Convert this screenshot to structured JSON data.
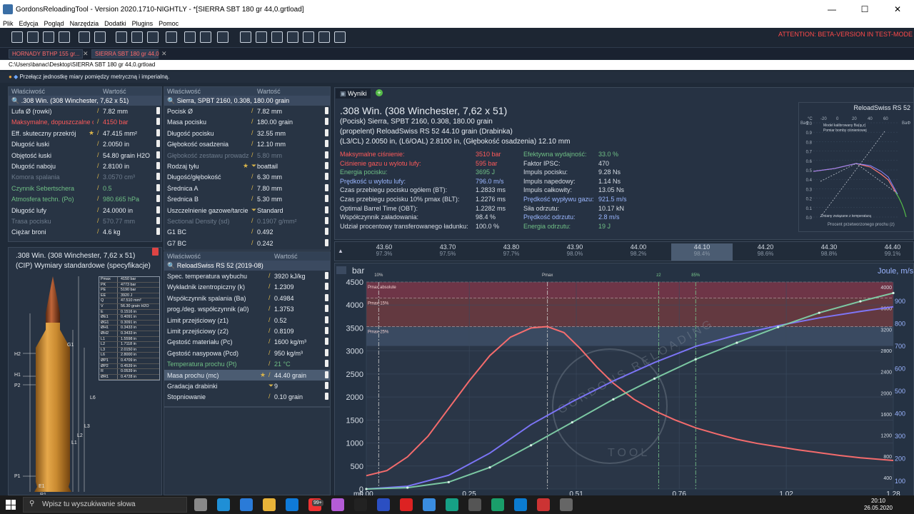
{
  "window": {
    "title": "GordonsReloadingTool - Version 2020.1710-NIGHTLY - *[SIERRA SBT 180 gr  44,0.grtload]",
    "minimize": "—",
    "maximize": "☐",
    "close": "✕"
  },
  "menu": [
    "Plik",
    "Edycja",
    "Pogląd",
    "Narzędzia",
    "Dodatki",
    "Plugins",
    "Pomoc"
  ],
  "attention": "ATTENTION: BETA-VERSION IN TEST-MODE",
  "tabs": [
    {
      "label": "HORNADY BTHP 155 gr..."
    },
    {
      "label": "SIERRA SBT 180 gr  44,0"
    }
  ],
  "tab_close": "✕",
  "path": "C:\\Users\\banac\\Desktop\\SIERRA SBT 180 gr  44,0.grtload",
  "hint": "Przełącz jednostkę miary pomiędzy metryczną i imperialną.",
  "colhdr": {
    "property": "Właściwość",
    "value": "Wartość"
  },
  "cartridge": {
    "name": ".308 Win. (308 Winchester, 7,62 x 51)",
    "rows": [
      {
        "n": "Lufa Ø (rowki)",
        "v": "7.82 mm",
        "c": ""
      },
      {
        "n": "Maksymalne, dopuszczalne ciśnienie",
        "v": "4150 bar",
        "c": "red"
      },
      {
        "n": "Eff. skuteczny przekrój",
        "v": "47.415 mm²",
        "c": "",
        "star": true
      },
      {
        "n": "Długość łuski",
        "v": "2.0050 in",
        "c": ""
      },
      {
        "n": "Objętość łuski",
        "v": "54.80 grain H2O",
        "c": ""
      },
      {
        "n": "Długość naboju",
        "v": "2.8100 in",
        "c": ""
      },
      {
        "n": "Komora spalania",
        "v": "3.0570 cm³",
        "c": "dim"
      },
      {
        "n": "Czynnik Sebertschera",
        "v": "0.5",
        "c": "green"
      },
      {
        "n": "Atmosfera techn. (Po)",
        "v": "980.665 hPa",
        "c": "green"
      },
      {
        "n": "Długość lufy",
        "v": "24.0000 in",
        "c": ""
      },
      {
        "n": "Trasa pocisku",
        "v": "570.77 mm",
        "c": "dim"
      },
      {
        "n": "Ciężar broni",
        "v": "4.6 kg",
        "c": ""
      }
    ]
  },
  "bullet": {
    "name": "Sierra, SPBT 2160, 0.308, 180.00 grain",
    "rows": [
      {
        "n": "Pocisk Ø",
        "v": "7.82 mm",
        "c": ""
      },
      {
        "n": "Masa pocisku",
        "v": "180.00 grain",
        "c": ""
      },
      {
        "n": "Długość pocisku",
        "v": "32.55 mm",
        "c": ""
      },
      {
        "n": "Głębokość osadzenia",
        "v": "12.10 mm",
        "c": ""
      },
      {
        "n": "Głębokość zestawu prowadzącego",
        "v": "5.80 mm",
        "c": "dim"
      },
      {
        "n": "Rodzaj tyłu",
        "v": "boattail",
        "c": "",
        "star": true,
        "dd": true
      },
      {
        "n": "Długość/głębokość",
        "v": "6.30 mm",
        "c": ""
      },
      {
        "n": "Średnica A",
        "v": "7.80 mm",
        "c": ""
      },
      {
        "n": "Średnica B",
        "v": "5.30 mm",
        "c": ""
      },
      {
        "n": "Uszczelnienie gazowe/tarcie",
        "v": "Standard",
        "c": "",
        "dd": true
      },
      {
        "n": "Sectional Density (sd)",
        "v": "0.1907 g/mm²",
        "c": "dim"
      },
      {
        "n": "G1 BC",
        "v": "0.492",
        "c": ""
      },
      {
        "n": "G7 BC",
        "v": "0.242",
        "c": ""
      }
    ]
  },
  "powder": {
    "name": "ReloadSwiss RS 52 (2019-08)",
    "rows": [
      {
        "n": "Spec. temperatura wybuchu (Qex)",
        "v": "3920 kJ/kg",
        "c": ""
      },
      {
        "n": "Wykładnik izentropiczny (k)",
        "v": "1.2309",
        "c": ""
      },
      {
        "n": "Współczynnik spalania (Ba)",
        "v": "0.4984",
        "c": ""
      },
      {
        "n": "prog./deg. współczynnik (a0)",
        "v": "1.3753",
        "c": ""
      },
      {
        "n": "Limit przejściowy (z1)",
        "v": "0.52",
        "c": ""
      },
      {
        "n": "Limit przejściowy (z2)",
        "v": "0.8109",
        "c": ""
      },
      {
        "n": "Gęstość materiału (Pc)",
        "v": "1600 kg/m³",
        "c": ""
      },
      {
        "n": "Gęstość nasypowa (Pcd)",
        "v": "950 kg/m³",
        "c": ""
      },
      {
        "n": "Temperatura prochu (Pt)",
        "v": "21 °C",
        "c": "green"
      },
      {
        "n": "Masa prochu (mc)",
        "v": "44.40 grain",
        "c": "sel",
        "star": true
      },
      {
        "n": "Gradacja drabinki",
        "v": "9",
        "c": "",
        "dd": true
      },
      {
        "n": "Stopniowanie",
        "v": "0.10 grain",
        "c": ""
      }
    ]
  },
  "cip": {
    "title1": ".308 Win. (308 Winchester, 7,62 x 51)",
    "title2": "(CIP) Wymiary standardowe (specyfikacje)",
    "table": [
      [
        "Pmax",
        "4150 bar"
      ],
      [
        "PK",
        "4773 bar"
      ],
      [
        "PE",
        "5190 bar"
      ],
      [
        "EE",
        "3920 J"
      ],
      [
        "Q",
        "47.510 mm²"
      ],
      [
        "V",
        "56.30 grain H2O"
      ],
      [
        "E",
        "0.1516 in"
      ],
      [
        "ØE1",
        "0.4091 in"
      ],
      [
        "ØG1",
        "0.3091 in"
      ],
      [
        "ØH1",
        "0.3433 in"
      ],
      [
        "ØH2",
        "0.3433 in"
      ],
      [
        "L1",
        "1.5598 in"
      ],
      [
        "L2",
        "1.7118 in"
      ],
      [
        "L3",
        "2.0150 in"
      ],
      [
        "L6",
        "2.8000 in"
      ],
      [
        "ØP1",
        "0.4709 in"
      ],
      [
        "ØP2",
        "0.4539 in"
      ],
      [
        "R",
        "0.0539 in"
      ],
      [
        "ØR1",
        "0.4728 in"
      ]
    ],
    "labels": [
      "H2",
      "G1",
      "H1",
      "P2",
      "L6",
      "L3",
      "L2",
      "L1",
      "P1",
      "E1",
      "R1"
    ]
  },
  "results": {
    "tab": "Wyniki",
    "title": ".308 Win. (308 Winchester, 7,62 x 51)",
    "lines": [
      "(Pocisk) Sierra, SPBT 2160, 0.308, 180.00 grain",
      "(propelent) ReloadSwiss RS 52 44.10 grain (Drabinka)",
      "(L3/CL) 2.0050 in, (L6/OAL) 2.8100 in, (Głębokość osadzenia) 12.10 mm"
    ],
    "left": [
      {
        "n": "Maksymalne ciśnienie:",
        "v": "3510 bar",
        "c": "red"
      },
      {
        "n": "Ciśnienie gazu u wylotu lufy:",
        "v": "595 bar",
        "c": "red"
      },
      {
        "n": "Energia pocisku:",
        "v": "3695 J",
        "c": "green"
      },
      {
        "n": "Prędkość u wylotu lufy:",
        "v": "796.0 m/s",
        "c": "blue"
      },
      {
        "n": "Czas przebiegu pocisku ogółem (BT):",
        "v": "1.2833 ms",
        "c": ""
      },
      {
        "n": "Czas przebiegu pocisku 10% pmax (BLT):",
        "v": "1.2276 ms",
        "c": ""
      },
      {
        "n": "Optimal Barrel Time (OBT):",
        "v": "1.2282 ms",
        "c": ""
      },
      {
        "n": "Współczynnik załadowania:",
        "v": "98.4 %",
        "c": ""
      },
      {
        "n": "Udział procentowy transferowanego ładunku:",
        "v": "100.0 %",
        "c": ""
      }
    ],
    "right": [
      {
        "n": "Efektywna wydajność:",
        "v": "33.0 %",
        "c": "green"
      },
      {
        "n": "Faktor IPSC:",
        "v": "470",
        "c": ""
      },
      {
        "n": "Impuls pocisku:",
        "v": "9.28 Ns",
        "c": ""
      },
      {
        "n": "Impuls napedowy:",
        "v": "1.14 Ns",
        "c": ""
      },
      {
        "n": "Impuls całkowity:",
        "v": "13.05 Ns",
        "c": ""
      },
      {
        "n": "Prędkość wypływu gazu:",
        "v": "921.5 m/s",
        "c": "blue"
      },
      {
        "n": "Siła odrzutu:",
        "v": "10.17 kN",
        "c": ""
      },
      {
        "n": "Prędkość odrzutu:",
        "v": "2.8 m/s",
        "c": "blue"
      },
      {
        "n": "Energia odrzutu:",
        "v": "19 J",
        "c": "green"
      }
    ]
  },
  "mini": {
    "title": "ReloadSwiss RS 52",
    "legend1": "Model kalibrowany Ba(φ,z)",
    "legend2": "Pomiar bomby ciśnieniowej",
    "note": "Zmiany związane z temperaturą",
    "xlabel": "Procent przetworzonego prochu (z)",
    "yticks": [
      "1.0",
      "0.9",
      "0.8",
      "0.7",
      "0.6",
      "0.5",
      "0.4",
      "0.3",
      "0.2",
      "0.1",
      "0.0"
    ],
    "xticks": [
      "-20",
      "0",
      "20",
      "40",
      "60"
    ],
    "xunit": "°C",
    "yunit": "BaΦ",
    "yunit2": "BaΦ"
  },
  "ladder": [
    {
      "g": "43.60",
      "p": "97.3%"
    },
    {
      "g": "43.70",
      "p": "97.5%"
    },
    {
      "g": "43.80",
      "p": "97.7%"
    },
    {
      "g": "43.90",
      "p": "98.0%"
    },
    {
      "g": "44.00",
      "p": "98.2%"
    },
    {
      "g": "44.10",
      "p": "98.4%",
      "sel": true
    },
    {
      "g": "44.20",
      "p": "98.6%"
    },
    {
      "g": "44.30",
      "p": "98.8%"
    },
    {
      "g": "44.40",
      "p": "99.1%"
    }
  ],
  "chart_data": {
    "type": "line",
    "xlabel": "ms",
    "ylabel": "bar",
    "ylabel2": "Joule, m/s",
    "xticks": [
      "0.00",
      "0.25",
      "0.51",
      "0.76",
      "1.02",
      "1.28"
    ],
    "yticks": [
      "0",
      "500",
      "1000",
      "1500",
      "2000",
      "2500",
      "3000",
      "3500",
      "4000",
      "4500"
    ],
    "y2ticks": [
      "400",
      "800",
      "1200",
      "1600",
      "2000",
      "2400",
      "2800",
      "3200",
      "3600",
      "4000"
    ],
    "y3ticks": [
      "100",
      "200",
      "300",
      "400",
      "500",
      "600",
      "700",
      "800",
      "900"
    ],
    "xlim": [
      0,
      1.28
    ],
    "ylim": [
      0,
      4500
    ],
    "bands": [
      {
        "name": "Pmax absolute",
        "lo": 4150,
        "hi": 4500
      },
      {
        "name": "Pmax-15%",
        "lo": 3530,
        "hi": 4150
      },
      {
        "name": "Pmax-25%",
        "lo": 3110,
        "hi": 3530
      }
    ],
    "markers": [
      {
        "label": "10%",
        "x": 0.03
      },
      {
        "label": "Pmax",
        "x": 0.44
      },
      {
        "label": "z2",
        "x": 0.71
      },
      {
        "label": "85%",
        "x": 0.8
      }
    ],
    "series": [
      {
        "name": "pressure",
        "color": "#ff6f6f",
        "x": [
          0,
          0.05,
          0.1,
          0.15,
          0.2,
          0.25,
          0.3,
          0.35,
          0.4,
          0.44,
          0.48,
          0.52,
          0.56,
          0.6,
          0.65,
          0.7,
          0.75,
          0.8,
          0.85,
          0.9,
          0.95,
          1.0,
          1.05,
          1.1,
          1.15,
          1.2,
          1.28
        ],
        "y": [
          290,
          400,
          700,
          1150,
          1750,
          2350,
          2900,
          3300,
          3500,
          3530,
          3400,
          3050,
          2650,
          2300,
          1950,
          1700,
          1500,
          1330,
          1200,
          1080,
          990,
          920,
          850,
          790,
          730,
          680,
          620
        ]
      },
      {
        "name": "energy",
        "color": "#7f78ff",
        "x": [
          0,
          0.1,
          0.2,
          0.3,
          0.4,
          0.5,
          0.6,
          0.7,
          0.8,
          0.9,
          1.0,
          1.1,
          1.2,
          1.28
        ],
        "y": [
          0,
          60,
          300,
          780,
          1400,
          1900,
          2350,
          2750,
          3100,
          3350,
          3550,
          3720,
          3860,
          3960
        ]
      },
      {
        "name": "velocity",
        "color": "#7fd0a8",
        "x": [
          0,
          0.1,
          0.2,
          0.3,
          0.4,
          0.5,
          0.6,
          0.7,
          0.8,
          0.9,
          1.0,
          1.1,
          1.2,
          1.28
        ],
        "y": [
          0,
          30,
          150,
          470,
          950,
          1450,
          1950,
          2400,
          2820,
          3180,
          3520,
          3830,
          4080,
          4260
        ]
      }
    ]
  },
  "watermark": {
    "top": "GORDONS RELOADING",
    "bottom": "TOOL"
  },
  "taskbar": {
    "search": "Wpisz tu wyszukiwanie słowa",
    "time": "20:10",
    "date": "26.05.2020",
    "badge": "99+"
  }
}
